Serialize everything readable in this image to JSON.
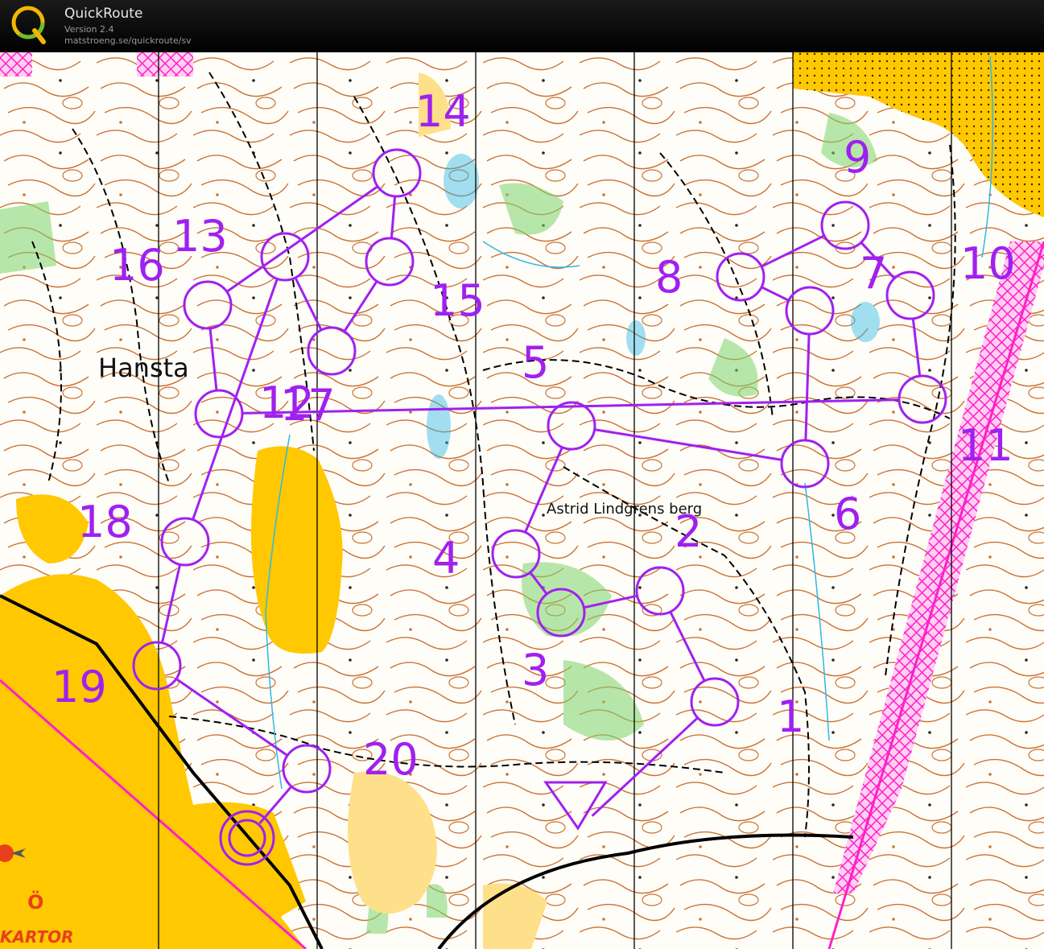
{
  "app": {
    "title": "QuickRoute",
    "version": "Version 2.4",
    "url": "matstroeng.se/quickroute/sv",
    "logo_letter": "Q"
  },
  "map": {
    "place_names": [
      "Hansta",
      "Astrid Lindgrens berg"
    ],
    "brand_text": "KARTOR",
    "brand_letter": "Ö",
    "control_labels": [
      "1",
      "2",
      "3",
      "4",
      "5",
      "6",
      "7",
      "8",
      "9",
      "10",
      "11",
      "12",
      "13",
      "14",
      "15",
      "16",
      "17",
      "18",
      "19",
      "20"
    ],
    "colors": {
      "course": "#a020f0",
      "contour": "#c05a14",
      "open_land": "#ffc800",
      "rough_open": "#ffe08a",
      "vegetation": "#7cd36b",
      "water": "#2fb8e6",
      "forbidden": "#ff20c8",
      "track": "#000000"
    }
  }
}
